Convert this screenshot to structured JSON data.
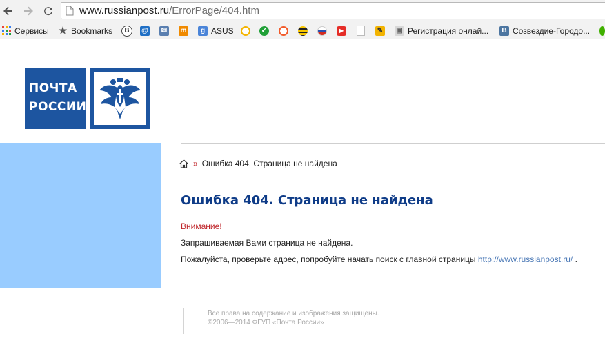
{
  "browser": {
    "url_host": "www.russianpost.ru",
    "url_path": "/ErrorPage/404.htm",
    "bookmarks": [
      {
        "label": "Сервисы",
        "icon": "apps-grid-icon",
        "color": "#e8453c"
      },
      {
        "label": "Bookmarks",
        "icon": "star-icon",
        "color": "#555555"
      },
      {
        "label": "",
        "icon": "bookmark-b-icon",
        "color": "#444444"
      },
      {
        "label": "",
        "icon": "at-mail-icon",
        "color": "#1f6fc5"
      },
      {
        "label": "",
        "icon": "envelope-icon",
        "color": "#5a7fb0"
      },
      {
        "label": "",
        "icon": "m-icon",
        "color": "#f08a00"
      },
      {
        "label": "ASUS",
        "icon": "g-plus-icon",
        "color": "#4a84d8"
      },
      {
        "label": "",
        "icon": "circle-multicolor-icon",
        "color": "#f4b400"
      },
      {
        "label": "",
        "icon": "sber-icon",
        "color": "#21a038"
      },
      {
        "label": "",
        "icon": "q-icon",
        "color": "#f25a29"
      },
      {
        "label": "",
        "icon": "beeline-icon",
        "color": "#222222"
      },
      {
        "label": "",
        "icon": "globe-flag-icon",
        "color": "#d52b1e"
      },
      {
        "label": "",
        "icon": "youtube-icon",
        "color": "#e52d27"
      },
      {
        "label": "",
        "icon": "blank-page-icon",
        "color": "#bbbbbb"
      },
      {
        "label": "",
        "icon": "pencil-icon",
        "color": "#f2b300"
      },
      {
        "label": "Регистрация онлай...",
        "icon": "package-icon",
        "color": "#7a7a7a"
      },
      {
        "label": "Созвездие-Городо...",
        "icon": "vk-icon",
        "color": "#4d76a1"
      },
      {
        "label": "",
        "icon": "green-dot-icon",
        "color": "#40b000"
      }
    ]
  },
  "page": {
    "logo_line1": "ПОЧТА",
    "logo_line2": "РОССИИ",
    "breadcrumb_current": "Ошибка 404. Страница не найдена",
    "title": "Ошибка 404. Страница не найдена",
    "warning": "Внимание!",
    "message1": "Запрашиваемая Вами страница не найдена.",
    "message2_prefix": "Пожалуйста, проверьте адрес, попробуйте начать поиск с главной страницы",
    "message2_link": "http://www.russianpost.ru/",
    "message2_suffix": " .",
    "footer_line1": "Все права на содержание и изображения защищены.",
    "footer_line2": "©2006—2014 ФГУП «Почта России»"
  },
  "colors": {
    "brand_blue": "#1d55a0",
    "side_block": "#99ccff",
    "title": "#0f3c88",
    "warning_red": "#c0282d",
    "link": "#4a78b6"
  }
}
